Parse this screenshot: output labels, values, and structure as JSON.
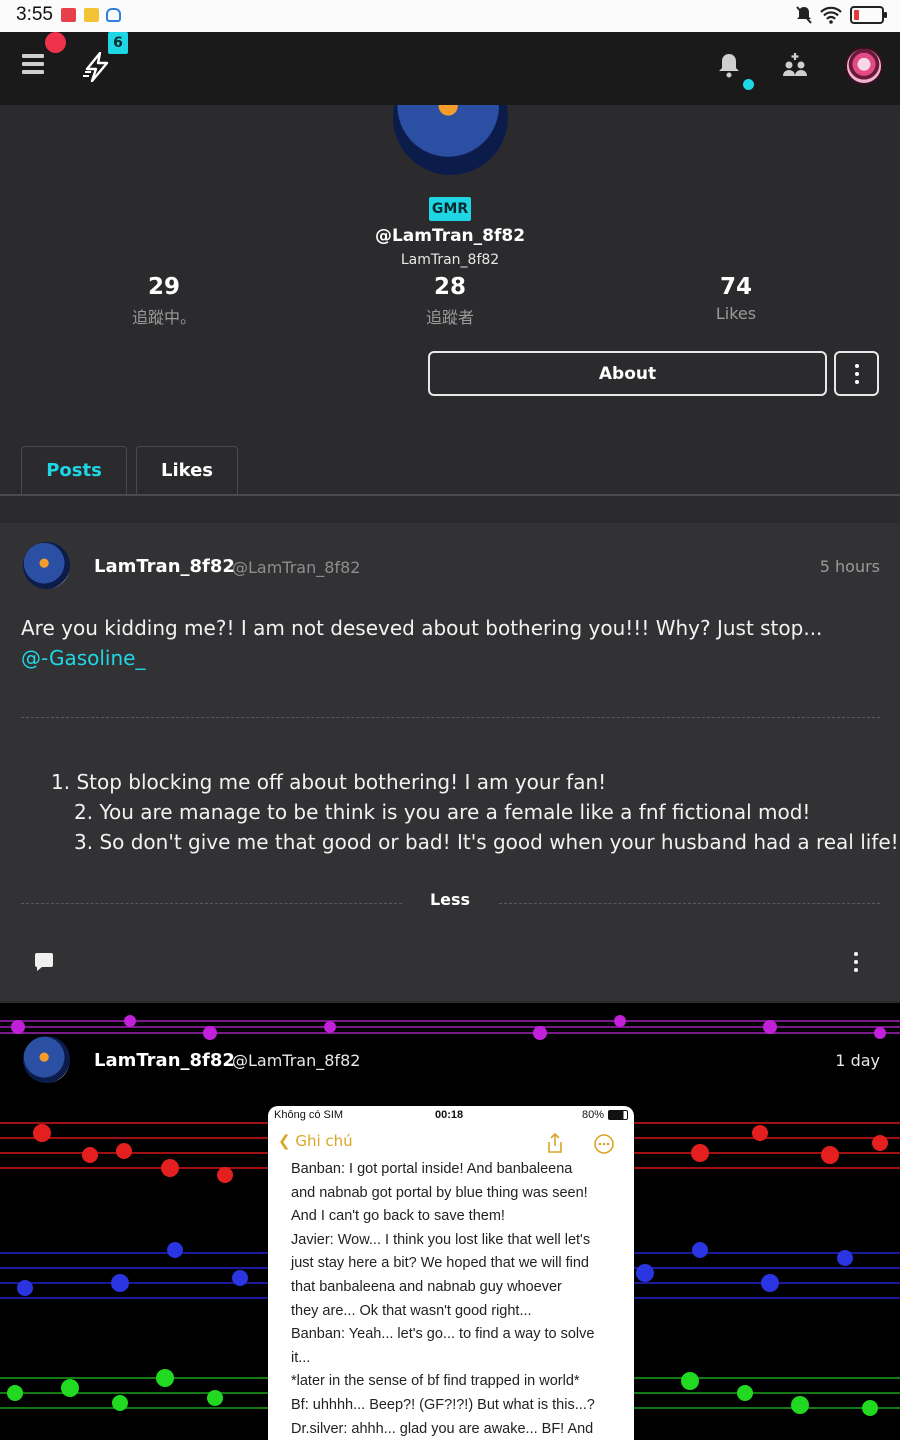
{
  "status_bar": {
    "time": "3:55"
  },
  "nav": {
    "badge_count": "6",
    "accent_color": "#1fd7e4"
  },
  "profile": {
    "badge": "GMR",
    "handle": "@LamTran_8f82",
    "username": "LamTran_8f82",
    "stats": [
      {
        "value": "29",
        "label": "追蹤中。"
      },
      {
        "value": "28",
        "label": "追蹤者"
      },
      {
        "value": "74",
        "label": "Likes"
      }
    ],
    "about_label": "About"
  },
  "tabs": [
    {
      "label": "Posts",
      "active": true
    },
    {
      "label": "Likes",
      "active": false
    }
  ],
  "posts": [
    {
      "author": "LamTran_8f82",
      "handle": "@LamTran_8f82",
      "time": "5 hours",
      "text": "Are you kidding me?! I am not deseved about bothering you!!! Why? Just stop...",
      "mention": "@-Gasoline_",
      "list": [
        "1. Stop blocking me off about bothering! I am your fan!",
        "2. You are manage to be think is you are a female like a fnf fictional mod!",
        "3. So don't give me that good or bad! It's good when your husband had a real life!"
      ],
      "collapse_label": "Less"
    },
    {
      "author": "LamTran_8f82",
      "handle": "@LamTran_8f82",
      "time": "1 day",
      "screenshot": {
        "carrier": "Không có SIM",
        "time": "00:18",
        "battery": "80%",
        "back_label": "Ghi chú",
        "lines": [
          "Banban: I got portal inside! And banbaleena",
          "and nabnab got portal by blue thing was seen!",
          "And I can't go back to save them!",
          "Javier: Wow... I think you lost like that well let's",
          "just stay here a bit? We hoped that we will find",
          "that banbaleena and nabnab guy whoever",
          "they are... Ok that wasn't good right...",
          "Banban: Yeah... let's go... to find a way to solve",
          "it...",
          "*later in the sense of bf find trapped in world*",
          "Bf: uhhhh... Beep?! (GF?!?!) But what is this...?",
          "Dr.silver: ahhh... glad you are awake... BF! And"
        ]
      }
    }
  ]
}
